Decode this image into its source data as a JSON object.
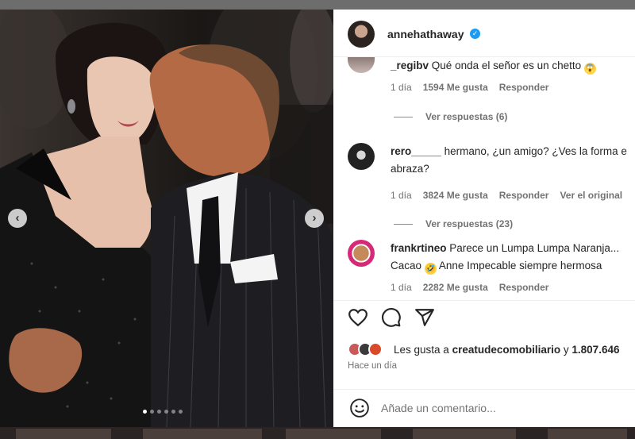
{
  "post": {
    "username": "annehathaway",
    "verified_symbol": "✓",
    "carousel": {
      "total_slides": 6,
      "active_slide": 1,
      "prev_symbol": "‹",
      "next_symbol": "›"
    }
  },
  "comments": [
    {
      "username": "_regibv",
      "text": "Qué onda el señor es un chetto",
      "emoji": "screaming-face-emoji",
      "time": "1 día",
      "likes": "1594 Me gusta",
      "reply_label": "Responder",
      "view_replies": "Ver respuestas (6)"
    },
    {
      "username": "rero_____",
      "text_line1": "hermano, ¿un amigo? ¿Ves la forma e",
      "text_line2": "abraza?",
      "time": "1 día",
      "likes": "3824 Me gusta",
      "reply_label": "Responder",
      "see_original": "Ver el original",
      "view_replies": "Ver respuestas (23)"
    },
    {
      "username": "frankrtineo",
      "text_line1": "Parece un Lumpa Lumpa Naranja...",
      "text_line2a": "Cacao",
      "text_line2b": "Anne Impecable siempre hermosa",
      "emoji": "rolling-laughing-emoji",
      "time": "1 día",
      "likes": "2282 Me gusta",
      "reply_label": "Responder"
    }
  ],
  "likes": {
    "prefix": "Les gusta a",
    "user": "creatudecomobiliario",
    "connector": "y",
    "count": "1.807.646"
  },
  "time_ago": "Hace un día",
  "comment_input": {
    "placeholder": "Añade un comentario..."
  },
  "colors": {
    "verified": "#1d9bf0",
    "text_primary": "#262626",
    "text_secondary": "#737373",
    "panel_bg": "#ffffff",
    "story_ring": "#d62976"
  }
}
